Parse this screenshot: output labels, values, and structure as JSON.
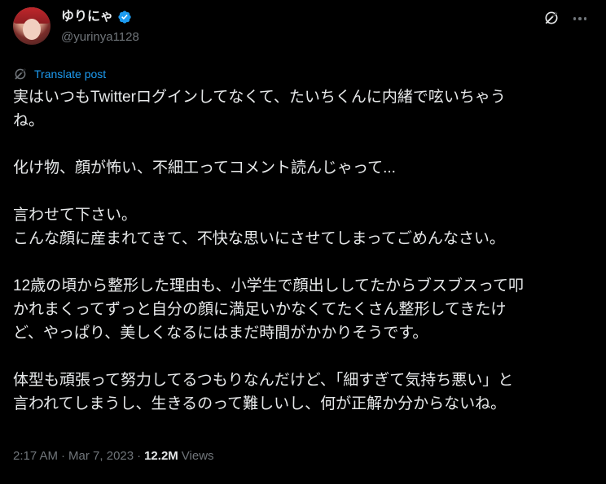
{
  "author": {
    "display_name": "ゆりにゃ",
    "handle": "@yurinya1128",
    "verified": true,
    "avatar_icon": "avatar-photo"
  },
  "actions": {
    "grok_icon": "grok-icon",
    "more_icon": "more-icon"
  },
  "translate": {
    "label": "Translate post"
  },
  "post": {
    "lines": [
      "実はいつもTwitterログインしてなくて、たいちくんに内緒で呟いちゃう",
      "ね。",
      "",
      "化け物、顔が怖い、不細工ってコメント読んじゃって...",
      "",
      "言わせて下さい。",
      "こんな顔に産まれてきて、不快な思いにさせてしまってごめんなさい。",
      "",
      "12歳の頃から整形した理由も、小学生で顔出ししてたからブスブスって叩",
      "かれまくってずっと自分の顔に満足いかなくてたくさん整形してきたけ",
      "ど、やっぱり、美しくなるにはまだ時間がかかりそうです。",
      "",
      "体型も頑張って努力してるつもりなんだけど、「細すぎて気持ち悪い」と",
      "言われてしまうし、生きるのって難しいし、何が正解か分からないね。"
    ]
  },
  "meta": {
    "time": "2:17 AM",
    "separator": "·",
    "date": "Mar 7, 2023",
    "views_count": "12.2M",
    "views_label": "Views"
  },
  "colors": {
    "background": "#000000",
    "text": "#e7e9ea",
    "muted": "#71767b",
    "link": "#1d9bf0",
    "verified": "#1d9bf0"
  }
}
